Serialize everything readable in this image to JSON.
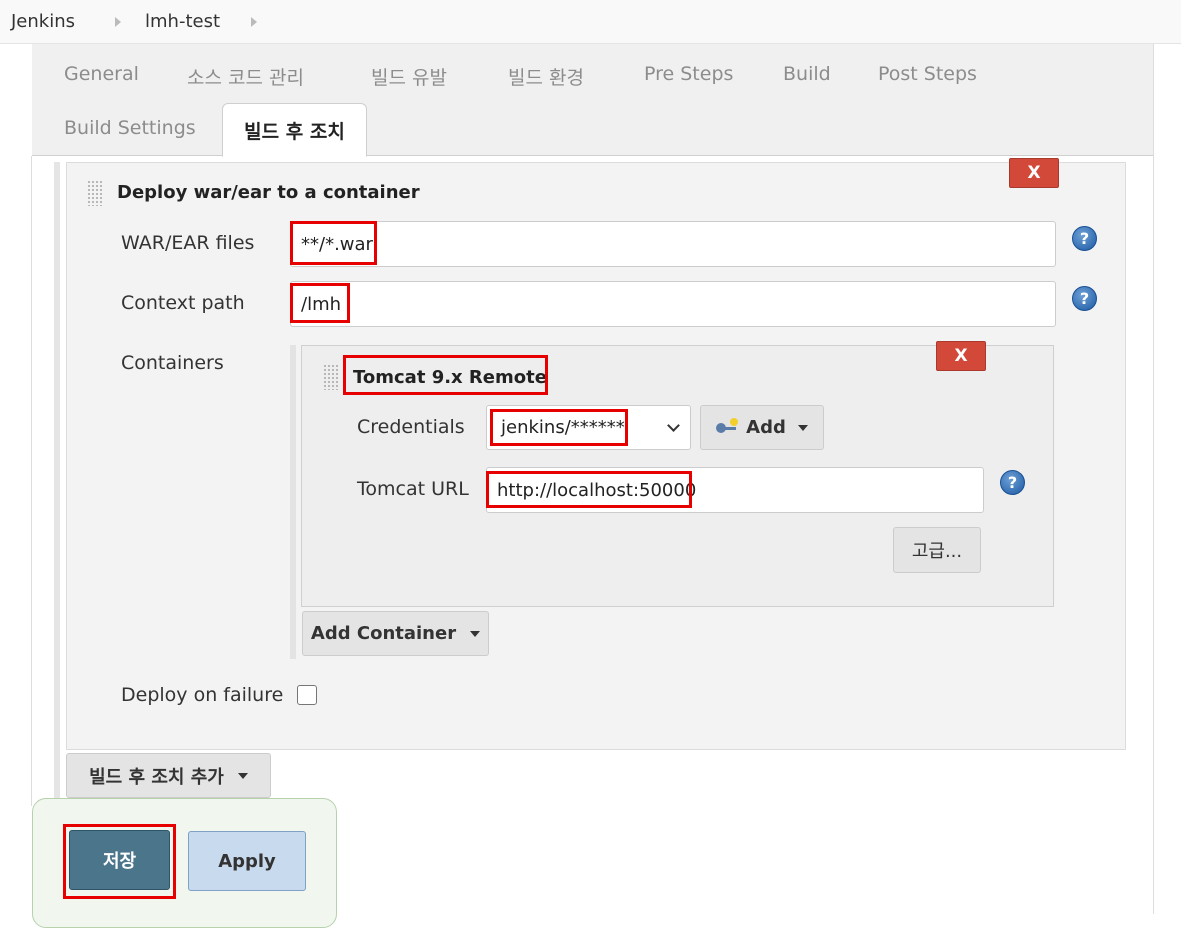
{
  "breadcrumb": {
    "items": [
      {
        "label": "Jenkins"
      },
      {
        "label": "lmh-test"
      }
    ]
  },
  "tabs": [
    {
      "label": "General"
    },
    {
      "label": "소스 코드 관리"
    },
    {
      "label": "빌드 유발"
    },
    {
      "label": "빌드 환경"
    },
    {
      "label": "Pre Steps"
    },
    {
      "label": "Build"
    },
    {
      "label": "Post Steps"
    },
    {
      "label": "Build Settings"
    },
    {
      "label": "빌드 후 조치",
      "active": true
    }
  ],
  "deploy": {
    "title": "Deploy war/ear to a container",
    "delete_label": "X",
    "war_label": "WAR/EAR files",
    "war_value": "**/*.war",
    "context_label": "Context path",
    "context_value": "/lmh",
    "containers_label": "Containers",
    "help_label": "?",
    "container": {
      "title": "Tomcat 9.x Remote",
      "delete_label": "X",
      "credentials_label": "Credentials",
      "credentials_value": "jenkins/******",
      "add_label": "Add",
      "url_label": "Tomcat URL",
      "url_value": "http://localhost:50000",
      "advanced_label": "고급..."
    },
    "add_container_label": "Add Container",
    "failure_label": "Deploy on failure",
    "failure_checked": false
  },
  "add_post_build_label": "빌드 후 조치 추가",
  "actions": {
    "save_label": "저장",
    "apply_label": "Apply"
  },
  "colors": {
    "highlight": "#e60000",
    "delete": "#d24939",
    "save": "#4b758b",
    "apply": "#c8daee"
  }
}
